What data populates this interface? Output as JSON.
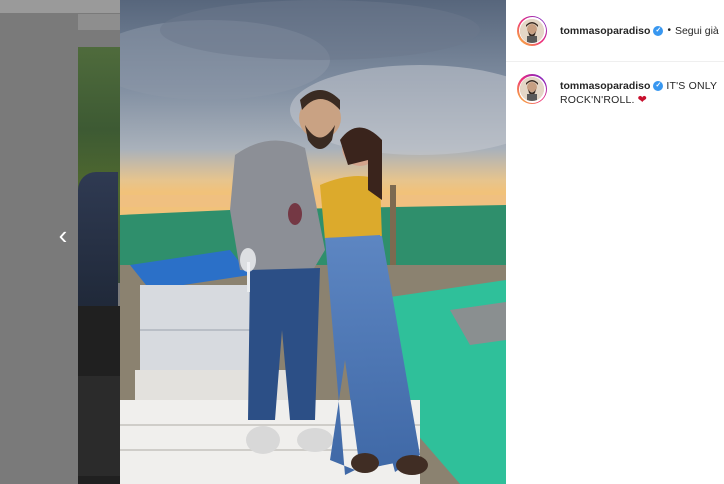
{
  "post": {
    "username": "tommasoparadiso",
    "follow_status": "Segui già",
    "caption": "IT'S ONLY ROCK'N'ROLL.",
    "caption_emoji": "❤"
  },
  "icons": {
    "prev": "chevron-left-icon",
    "verified": "verified-badge-icon"
  },
  "colors": {
    "verified": "#3897f0",
    "heart": "#c8102e",
    "overlay_bg": "#7a7a7a"
  }
}
